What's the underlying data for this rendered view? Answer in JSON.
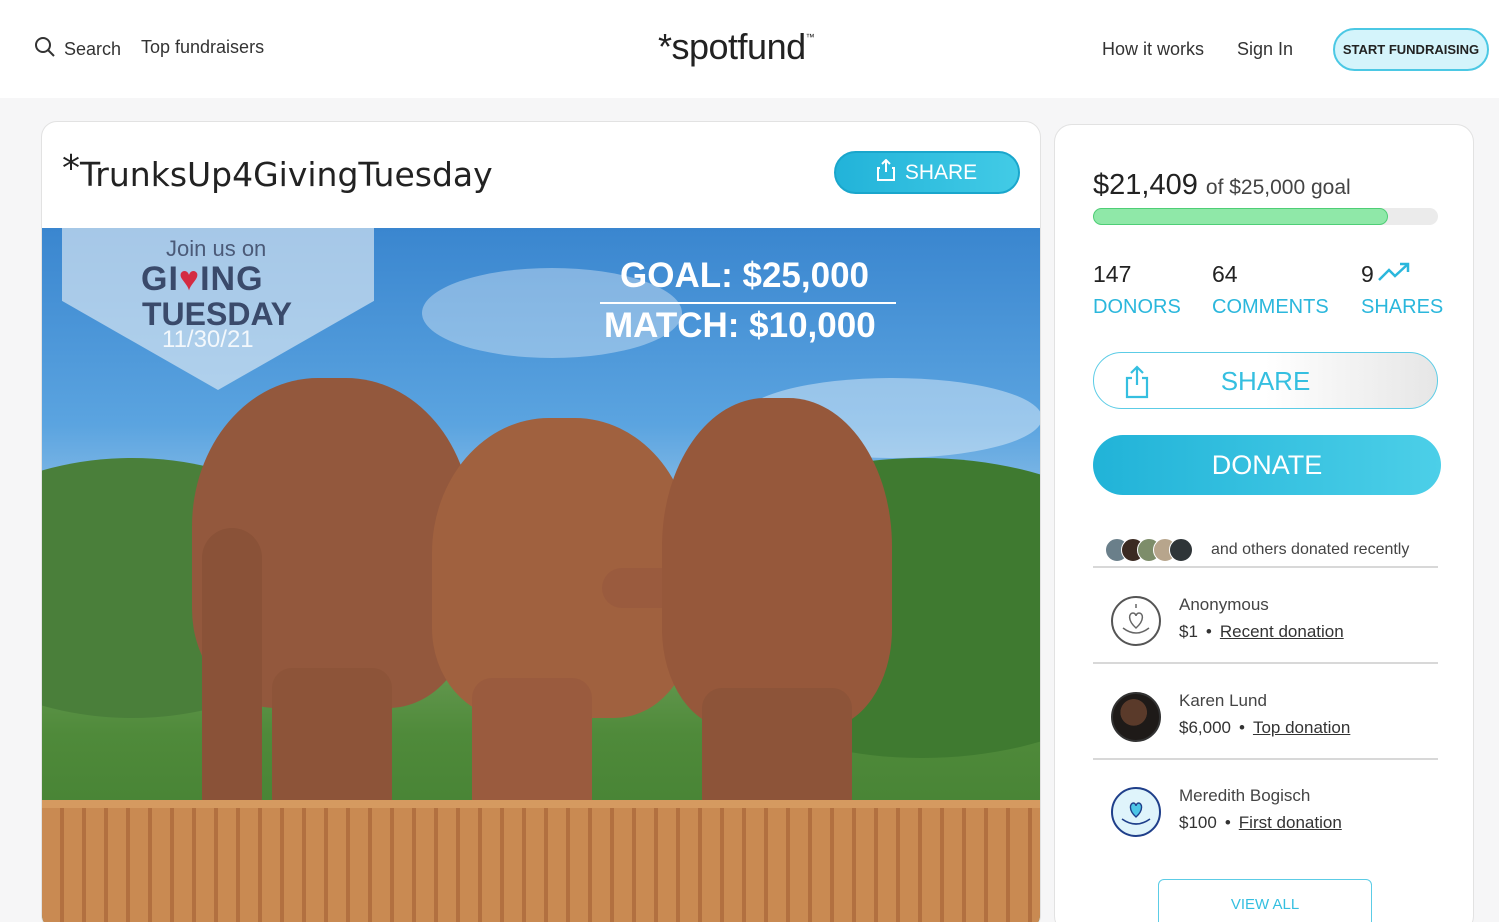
{
  "header": {
    "search_label": "Search",
    "top_fundraisers": "Top fundraisers",
    "logo": "*spotfund",
    "logo_tm": "™",
    "how_it_works": "How it works",
    "sign_in": "Sign In",
    "start_fundraising": "START FUNDRAISING"
  },
  "campaign": {
    "title_asterisk": "*",
    "title": "TrunksUp4GivingTuesday",
    "share_label": "SHARE",
    "image": {
      "join_text": "Join us on",
      "giving_pre": "GI",
      "giving_heart": "♥",
      "giving_post": "ING",
      "tuesday": "TUESDAY",
      "date": "11/30/21",
      "goal_text": "GOAL: $25,000",
      "match_text": "MATCH: $10,000"
    }
  },
  "sidebar": {
    "raised": "$21,409",
    "goal_text": "of $25,000 goal",
    "progress_fraction": 0.856,
    "stats": {
      "donors_count": "147",
      "donors_label": "DONORS",
      "comments_count": "64",
      "comments_label": "COMMENTS",
      "shares_count": "9",
      "shares_label": "SHARES"
    },
    "share_label": "SHARE",
    "donate_label": "DONATE",
    "recent_text": "and others donated recently",
    "donors": [
      {
        "name": "Anonymous",
        "amount": "$1",
        "tag": "Recent donation",
        "dot": "•"
      },
      {
        "name": "Karen Lund",
        "amount": "$6,000",
        "tag": "Top donation",
        "dot": "•"
      },
      {
        "name": "Meredith Bogisch",
        "amount": "$100",
        "tag": "First donation",
        "dot": "•"
      }
    ],
    "view_all": "VIEW ALL"
  },
  "colors": {
    "accent": "#2bb7dc",
    "progress": "#8fe8a8"
  }
}
